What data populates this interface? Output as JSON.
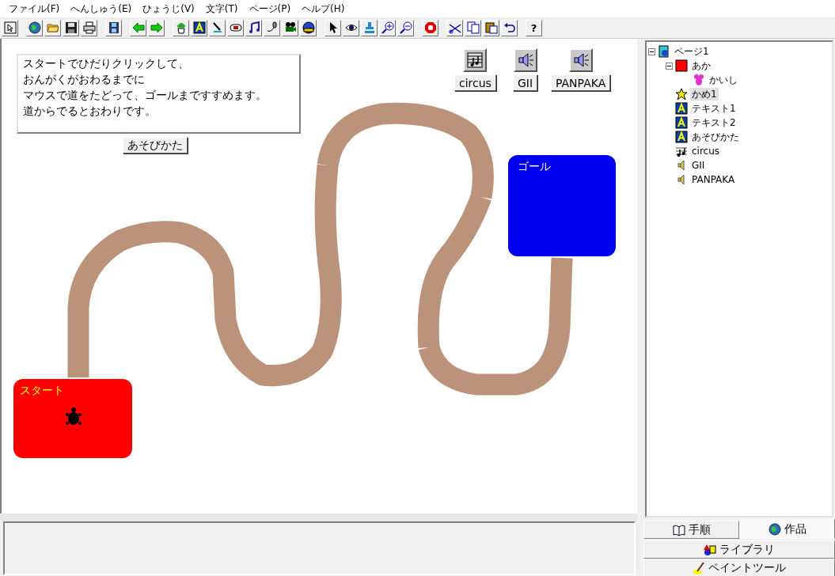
{
  "menu": [
    {
      "label": "ファイル(F)"
    },
    {
      "label": "へんしゅう(E)"
    },
    {
      "label": "ひょうじ(V)"
    },
    {
      "label": "文字(T)"
    },
    {
      "label": "ページ(P)"
    },
    {
      "label": "ヘルプ(H)"
    }
  ],
  "toolbar": {
    "help_label": "?"
  },
  "stage": {
    "instructions": [
      "スタートでひだりクリックして、",
      "おんがくがおわるまでに",
      "マウスで道をたどって、ゴールまですすめます。",
      "道からでるとおわりです。"
    ],
    "instructions_button": "あそびかた",
    "sound_buttons": [
      {
        "label": "circus",
        "kind": "music"
      },
      {
        "label": "GII",
        "kind": "sound"
      },
      {
        "label": "PANPAKA",
        "kind": "sound"
      }
    ],
    "start_label": "スタート",
    "goal_label": "ゴール"
  },
  "tree": [
    {
      "label": "ページ1",
      "kind": "page",
      "selected": false,
      "expanded": true,
      "children": [
        {
          "label": "あか",
          "kind": "shape",
          "selected": false,
          "expanded": true,
          "children": [
            {
              "label": "かいし",
              "kind": "character",
              "selected": false
            }
          ]
        },
        {
          "label": "かめ1",
          "kind": "turtle",
          "selected": true
        },
        {
          "label": "テキスト1",
          "kind": "text",
          "selected": false
        },
        {
          "label": "テキスト2",
          "kind": "text",
          "selected": false
        },
        {
          "label": "あそびかた",
          "kind": "text",
          "selected": false
        },
        {
          "label": "circus",
          "kind": "music",
          "selected": false
        },
        {
          "label": "GII",
          "kind": "sound",
          "selected": false
        },
        {
          "label": "PANPAKA",
          "kind": "sound",
          "selected": false
        }
      ]
    }
  ],
  "tabs": [
    {
      "label": "手順",
      "kind": "book",
      "selected": false
    },
    {
      "label": "作品",
      "kind": "globe",
      "selected": true
    },
    {
      "label": "ライブラリ",
      "kind": "shapes",
      "selected": false
    },
    {
      "label": "ペイントツール",
      "kind": "brush",
      "selected": false
    }
  ]
}
